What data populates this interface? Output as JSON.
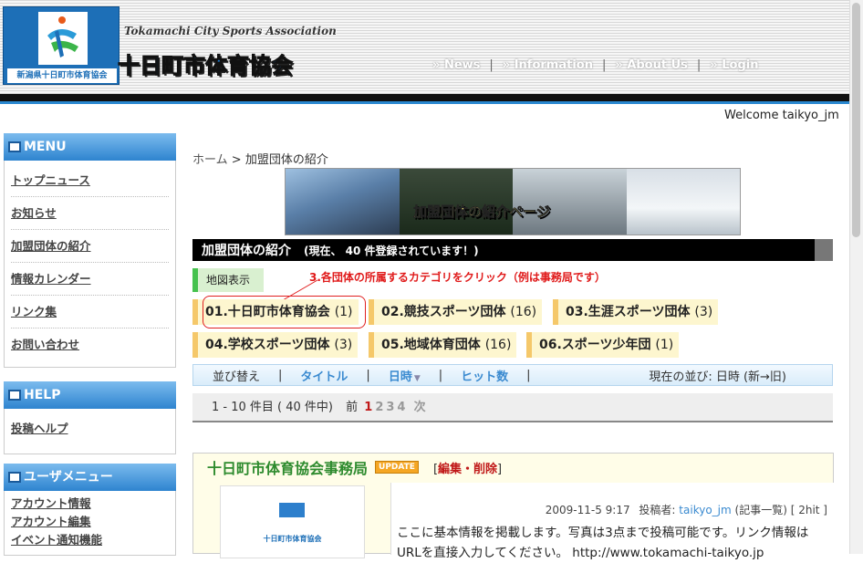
{
  "header": {
    "logo_caption": "新潟県十日町市体育協会",
    "site_name_en": "Tokamachi City Sports Association",
    "site_name_ja": "十日町市体育協会",
    "nav": [
      "News",
      "Information",
      "About Us",
      "Login"
    ],
    "nav_prefix": "»"
  },
  "welcome": "Welcome taikyo_jm",
  "sidebar": {
    "menu": {
      "title": "MENU",
      "items": [
        "トップニュース",
        "お知らせ",
        "加盟団体の紹介",
        "情報カレンダー",
        "リンク集",
        "お問い合わせ"
      ]
    },
    "help": {
      "title": "HELP",
      "items": [
        "投稿ヘルプ"
      ]
    },
    "user_menu": {
      "title": "ユーザメニュー",
      "items": [
        "アカウント情報",
        "アカウント編集",
        "イベント通知機能"
      ]
    }
  },
  "breadcrumb": {
    "home": "ホーム",
    "sep": ">",
    "current": "加盟団体の紹介"
  },
  "banner_text": "加盟団体の紹介ページ",
  "page_title": {
    "main": "加盟団体の紹介",
    "sub": "(現在、 40 件登録されています！)"
  },
  "map_button": "地図表示",
  "callout": "3.各団体の所属するカテゴリをクリック（例は事務局です）",
  "categories": [
    {
      "label": "01.十日町市体育協会",
      "count": "(1)"
    },
    {
      "label": "02.競技スポーツ団体",
      "count": "(16)"
    },
    {
      "label": "03.生涯スポーツ団体",
      "count": "(3)"
    },
    {
      "label": "04.学校スポーツ団体",
      "count": "(3)"
    },
    {
      "label": "05.地域体育団体",
      "count": "(16)"
    },
    {
      "label": "06.スポーツ少年団",
      "count": "(1)"
    }
  ],
  "sort": {
    "label": "並び替え",
    "title": "タイトル",
    "date": "日時",
    "date_arrow": "▼",
    "hits": "ヒット数",
    "current": "現在の並び: 日時 (新→旧)",
    "pipe": "|"
  },
  "pager": {
    "summary": "1 - 10 件目 ( 40 件中)",
    "prev": "前",
    "pages": [
      "1",
      "2",
      "3",
      "4"
    ],
    "next": "次",
    "active": "1"
  },
  "entry": {
    "title": "十日町市体育協会事務局",
    "badge": "UPDATE",
    "edit_prefix": "[",
    "edit": "編集・削除",
    "edit_suffix": "]",
    "thumb_caption": "十日町市体育協会",
    "date": "2009-11-5 9:17",
    "poster_label": "投稿者:",
    "poster": "taikyo_jm",
    "post_list": "(記事一覧)",
    "hits": "[ 2hit ]",
    "body": "ここに基本情報を掲載します。写真は3点まで投稿可能です。リンク情報はURLを直接入力してください。 http://www.tokamachi-taikyo.jp"
  },
  "colors": {
    "accent_blue": "#2a88d0",
    "title_green": "#2e8b2e",
    "callout_red": "#e01a1a",
    "cat_border": "#f5c86a",
    "map_green": "#46c24e"
  }
}
